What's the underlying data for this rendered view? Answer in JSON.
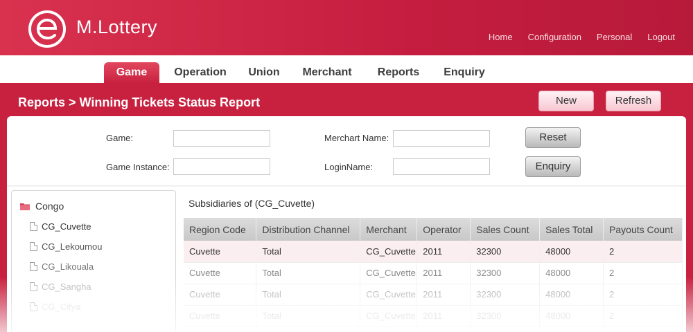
{
  "header": {
    "brand": "M.Lottery",
    "links": [
      "Home",
      "Configuration",
      "Personal",
      "Logout"
    ]
  },
  "tabs": [
    "Game",
    "Operation",
    "Union",
    "Merchant",
    "Reports",
    "Enquiry"
  ],
  "active_tab": "Game",
  "page": {
    "breadcrumb": "Reports > Winning Tickets Status Report",
    "new_label": "New",
    "refresh_label": "Refresh"
  },
  "filters": {
    "game_label": "Game:",
    "game_value": "",
    "game_instance_label": "Game Instance:",
    "game_instance_value": "",
    "merchant_name_label": "Merchart Name:",
    "merchant_name_value": "",
    "login_name_label": "LoginName:",
    "login_name_value": "",
    "reset_label": "Reset",
    "enquiry_label": "Enquiry"
  },
  "tree": {
    "root": "Congo",
    "items": [
      "CG_Cuvette",
      "CG_Lekoumou",
      "CG_Likouala",
      "CG_Sangha",
      "CG_Citya"
    ]
  },
  "table": {
    "caption": "Subsidiaries of (CG_Cuvette)",
    "columns": [
      "Region Code",
      "Distribution Channel",
      "Merchant",
      "Operator",
      "Sales Count",
      "Sales Total",
      "Payouts Count"
    ],
    "rows": [
      [
        "Cuvette",
        "Total",
        "CG_Cuvette",
        "2011",
        "32300",
        "48000",
        "2"
      ],
      [
        "Cuvette",
        "Total",
        "CG_Cuvette",
        "2011",
        "32300",
        "48000",
        "2"
      ],
      [
        "Cuvette",
        "Total",
        "CG_Cuvette",
        "2011",
        "32300",
        "48000",
        "2"
      ],
      [
        "Cuvette",
        "Total",
        "CG_Cuvette",
        "2011",
        "32300",
        "48000",
        "2"
      ]
    ]
  },
  "colors": {
    "brand_red": "#c8203f",
    "tab_active": "#d33650",
    "folder": "#d8405a"
  }
}
